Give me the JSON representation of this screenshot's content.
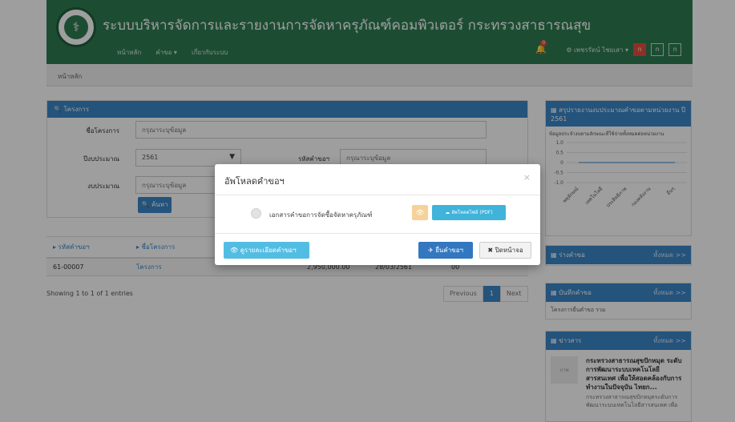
{
  "header": {
    "logo_icon": "ministry-seal-icon",
    "title": "ระบบบริหารจัดการและรายงานการจัดหาครุภัณฑ์คอมพิวเตอร์ กระทรวงสาธารณสุข",
    "nav": [
      "หน้าหลัก",
      "คำขอ ▾",
      "เกี่ยวกับระบบ"
    ],
    "notification_count": "0",
    "user_label": "⚙ เพชรรัตน์ ไชยเสา ▾",
    "font_sizes": [
      "ก",
      "ก",
      "ก"
    ],
    "accent": "#2e7d52"
  },
  "breadcrumb": "หน้าหลัก",
  "search": {
    "heading": "🔍 โครงการ",
    "fields": [
      {
        "label": "ชื่อโครงการ",
        "placeholder": "กรุณาระบุข้อมูล"
      },
      {
        "label": "ปีงบประมาณ",
        "value": "2561"
      },
      {
        "label": "รหัสคำขอฯ",
        "placeholder": "กรุณาระบุข้อมูล"
      },
      {
        "label": "งบประมาณ",
        "placeholder": "กรุณาระบุข้อมูล"
      }
    ],
    "button": "🔍 ค้นหา"
  },
  "table": {
    "headers": [
      "▸ รหัสคำขอฯ",
      "▸ ชื่อโครงการ"
    ],
    "rows": [
      [
        "61-00007",
        "โครงการ",
        "2,950,000.00",
        "28/03/2561",
        "00"
      ]
    ],
    "info": "Showing 1 to 1 of 1 entries",
    "pager": [
      "Previous",
      "1",
      "Next"
    ]
  },
  "sidebar": {
    "chart_box": {
      "heading": "▦ สรุปรายงานงบประมาณคำขอตามหน่วยงาน ปี 2561",
      "caption": "ข้อมูลประจำงบตามลักษณะที่ใช้จ่ายทั้งหมดต่อหน่วยงาน"
    },
    "boxes": [
      {
        "heading": "▦ ร่างคำขอ",
        "link": "ทั้งหมด >>"
      },
      {
        "heading": "▦ บันทึกคำขอ",
        "link": "ทั้งหมด >>",
        "body": "โครงการยื่นคำขอ รวม"
      },
      {
        "heading": "▦ ข่าวสาร",
        "link": "ทั้งหมด >>"
      }
    ],
    "news": {
      "thumb": "ภาพ",
      "title": "กระทรวงสาธารณสุขปักหมุด ระดับการพัฒนาระบบเทคโนโลยีสารสนเทศ เพื่อให้สอดคล้องกับการทำงานในปัจจุบัน ไทยก...",
      "desc": "กระทรวงสาธารณสุขปักหมุดระดับการพัฒนาระบบเทคโนโลยีสารสนเทศ เพื่อ"
    }
  },
  "chart_data": {
    "type": "line",
    "title": "",
    "categories": [
      "พหุลักษณ์",
      "เทคโนโลยี",
      "ประสิทธิภาพ",
      "กองคลังงาน",
      "อื่นๆ"
    ],
    "series": [
      {
        "values": [
          0,
          0,
          0,
          0,
          0
        ]
      }
    ],
    "ylim": [
      -1.0,
      1.0
    ],
    "yticks": [
      "1.0",
      "0.5",
      "0",
      "-0.5",
      "-1.0"
    ]
  },
  "modal": {
    "title": "อัพโหลดคำขอฯ",
    "close_x": "×",
    "doc_label": "เอกสารคำขอการจัดซื้อจัดหาครุภัณฑ์",
    "view_label": "👁",
    "upload_label": "☁ อัพโหลดไฟล์ (PDF)",
    "detail_button": "👁 ดูรายละเอียดคำขอฯ",
    "submit_button": "✈ ยื่นคำขอฯ",
    "close_button": "✖ ปิดหน้าจอ"
  }
}
